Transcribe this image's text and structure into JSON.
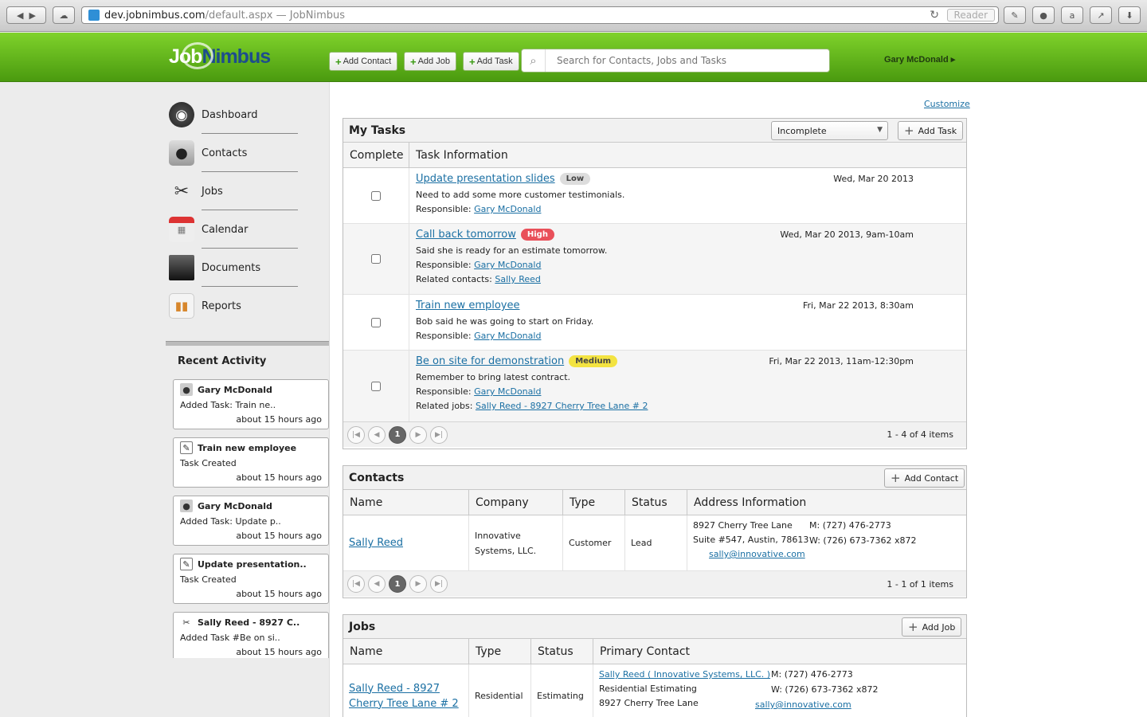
{
  "browser": {
    "url_host": "dev.jobnimbus.com",
    "url_path": "/default.aspx — JobNimbus",
    "reader_label": "Reader"
  },
  "header": {
    "logo_job": "Job",
    "logo_nimbus": "Nimbus",
    "add_contact": "Add Contact",
    "add_job": "Add Job",
    "add_task": "Add Task",
    "search_placeholder": "Search for Contacts, Jobs and Tasks",
    "user_name": "Gary McDonald ▸"
  },
  "nav": {
    "items": [
      {
        "label": "Dashboard",
        "icon": "dashboard-icon"
      },
      {
        "label": "Contacts",
        "icon": "contacts-icon"
      },
      {
        "label": "Jobs",
        "icon": "jobs-tools-icon"
      },
      {
        "label": "Calendar",
        "icon": "calendar-icon"
      },
      {
        "label": "Documents",
        "icon": "folder-icon"
      },
      {
        "label": "Reports",
        "icon": "reports-chart-icon"
      }
    ]
  },
  "recent_activity": {
    "title": "Recent Activity",
    "items": [
      {
        "title": "Gary McDonald",
        "desc": "Added Task: Train ne..",
        "time": "about 15 hours ago",
        "icon": "person-icon"
      },
      {
        "title": "Train new employee",
        "desc": "Task Created",
        "time": "about 15 hours ago",
        "icon": "task-note-icon"
      },
      {
        "title": "Gary McDonald",
        "desc": "Added Task: Update p..",
        "time": "about 15 hours ago",
        "icon": "person-icon"
      },
      {
        "title": "Update presentation..",
        "desc": "Task Created",
        "time": "about 15 hours ago",
        "icon": "task-note-icon"
      },
      {
        "title": "Sally Reed - 8927 C..",
        "desc": "Added Task #Be on si..",
        "time": "about 15 hours ago",
        "icon": "tools-icon"
      }
    ]
  },
  "customize_label": "Customize",
  "tasks": {
    "title": "My Tasks",
    "filter": "Incomplete",
    "add_label": "Add Task",
    "col_complete": "Complete",
    "col_info": "Task Information",
    "rows": [
      {
        "title": "Update presentation slides",
        "badge": "Low",
        "date": "Wed, Mar 20 2013",
        "desc": "Need to add some more customer testimonials.",
        "resp_label": "Responsible:",
        "resp": "Gary McDonald",
        "rel_label": "",
        "rel": ""
      },
      {
        "title": "Call back tomorrow",
        "badge": "High",
        "date": "Wed, Mar 20 2013, 9am-10am",
        "desc": "Said she is ready for an estimate tomorrow.",
        "resp_label": "Responsible:",
        "resp": "Gary McDonald",
        "rel_label": "Related contacts:",
        "rel": "Sally Reed"
      },
      {
        "title": "Train new employee",
        "badge": "",
        "date": "Fri, Mar 22 2013, 8:30am",
        "desc": "Bob said he was going to start on Friday.",
        "resp_label": "Responsible:",
        "resp": "Gary McDonald",
        "rel_label": "",
        "rel": ""
      },
      {
        "title": "Be on site for demonstration",
        "badge": "Medium",
        "date": "Fri, Mar 22 2013, 11am-12:30pm",
        "desc": "Remember to bring latest contract.",
        "resp_label": "Responsible:",
        "resp": "Gary McDonald",
        "rel_label": "Related jobs:",
        "rel": "Sally Reed - 8927 Cherry Tree Lane # 2"
      }
    ],
    "page": "1",
    "count": "1 - 4 of 4 items"
  },
  "contacts": {
    "title": "Contacts",
    "add_label": "Add Contact",
    "columns": [
      "Name",
      "Company",
      "Type",
      "Status",
      "Address Information"
    ],
    "row": {
      "name": "Sally Reed",
      "company": "Innovative Systems, LLC.",
      "type": "Customer",
      "status": "Lead",
      "addr1": "8927 Cherry Tree Lane",
      "addr2": "Suite #547, Austin, 78613",
      "email": "sally@innovative.com",
      "mobile": "M: (727) 476-2773",
      "work": "W: (726) 673-7362 x872"
    },
    "page": "1",
    "count": "1 - 1 of 1 items"
  },
  "jobs": {
    "title": "Jobs",
    "add_label": "Add Job",
    "columns": [
      "Name",
      "Type",
      "Status",
      "Primary Contact"
    ],
    "row": {
      "name": "Sally Reed - 8927 Cherry Tree Lane # 2",
      "type": "Residential",
      "status": "Estimating",
      "contact": "Sally Reed ( Innovative Systems, LLC. )",
      "line2": "Residential Estimating",
      "line3": "8927 Cherry Tree Lane",
      "mobile": "M: (727) 476-2773",
      "work": "W: (726) 673-7362 x872",
      "email": "sally@innovative.com"
    }
  }
}
